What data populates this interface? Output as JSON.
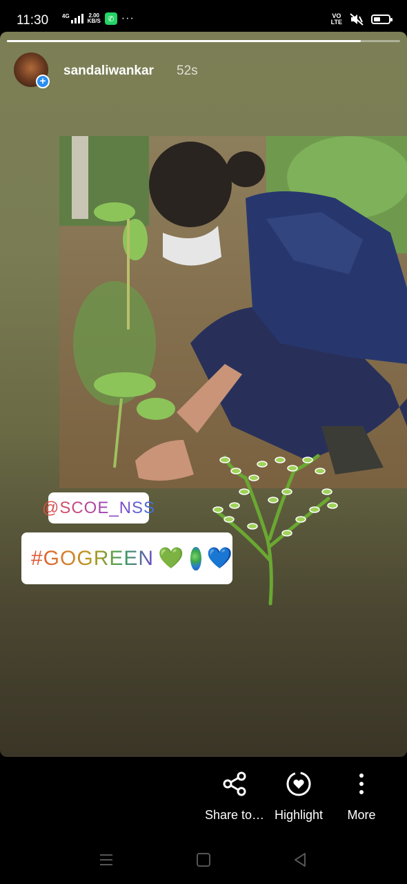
{
  "status_bar": {
    "time": "11:30",
    "network": "4G",
    "speed_value": "2.00",
    "speed_unit": "KB/S",
    "volte_top": "VO",
    "volte_bottom": "LTE",
    "battery_level": 0.45,
    "icons": [
      "signal-icon",
      "whatsapp-icon",
      "more-notifications-icon",
      "mute-vibrate-icon",
      "battery-icon"
    ]
  },
  "story": {
    "progress": 0.9,
    "username": "sandaliwankar",
    "time_ago": "52s",
    "mention_sticker": "@SCOE_NSS",
    "hashtag_sticker": "#GOGREEN",
    "hashtag_emojis": [
      "💚",
      "globe",
      "💙"
    ],
    "heart_green": "💚",
    "heart_blue": "💙"
  },
  "actions": [
    {
      "label": "Share to…",
      "icon": "share-icon"
    },
    {
      "label": "Highlight",
      "icon": "highlight-icon"
    },
    {
      "label": "More",
      "icon": "more-vertical-icon"
    }
  ],
  "nav": [
    "menu-icon",
    "home-icon",
    "back-icon"
  ]
}
